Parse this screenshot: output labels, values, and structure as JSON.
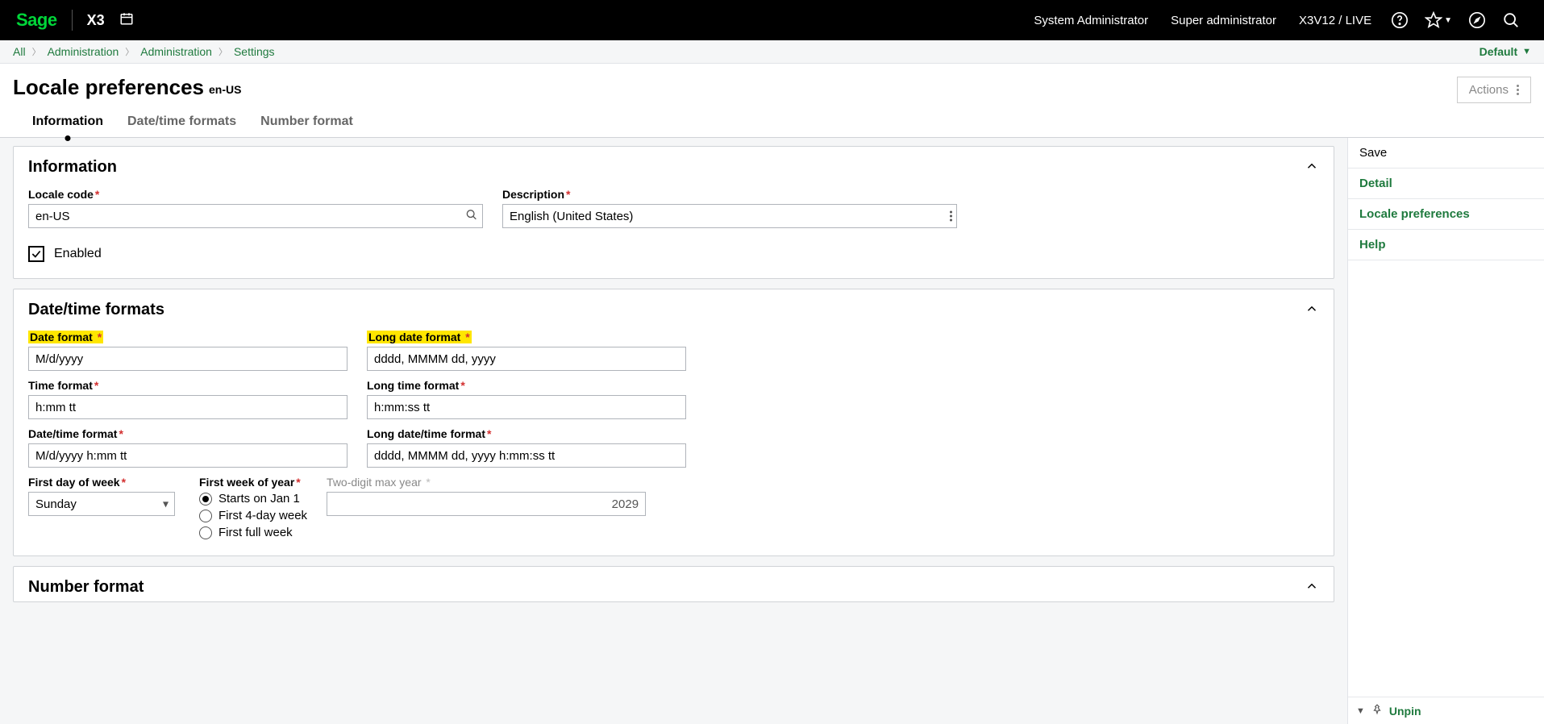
{
  "topbar": {
    "logo": "Sage",
    "product": "X3",
    "sys_admin": "System Administrator",
    "super_admin": "Super administrator",
    "env": "X3V12 / LIVE"
  },
  "breadcrumbs": {
    "b0": "All",
    "b1": "Administration",
    "b2": "Administration",
    "b3": "Settings",
    "default_label": "Default"
  },
  "page": {
    "title": "Locale preferences",
    "subtitle": "en-US",
    "actions_label": "Actions"
  },
  "tabs": {
    "t0": "Information",
    "t1": "Date/time formats",
    "t2": "Number format"
  },
  "info_section": {
    "title": "Information",
    "locale_code_label": "Locale code",
    "locale_code_value": "en-US",
    "description_label": "Description",
    "description_value": "English (United States)",
    "enabled_label": "Enabled"
  },
  "datetime_section": {
    "title": "Date/time formats",
    "date_format_label": "Date format",
    "date_format_value": "M/d/yyyy",
    "long_date_format_label": "Long date format",
    "long_date_format_value": "dddd, MMMM dd, yyyy",
    "time_format_label": "Time format",
    "time_format_value": "h:mm tt",
    "long_time_format_label": "Long time format",
    "long_time_format_value": "h:mm:ss tt",
    "datetime_format_label": "Date/time format",
    "datetime_format_value": "M/d/yyyy h:mm tt",
    "long_datetime_format_label": "Long date/time format",
    "long_datetime_format_value": "dddd, MMMM dd, yyyy h:mm:ss tt",
    "first_day_label": "First day of week",
    "first_day_value": "Sunday",
    "first_week_label": "First week of year",
    "radio_jan1": "Starts on Jan 1",
    "radio_4day": "First 4-day week",
    "radio_full": "First full week",
    "two_digit_label": "Two-digit max year",
    "two_digit_value": "2029"
  },
  "number_section": {
    "title": "Number format"
  },
  "right_panel": {
    "save": "Save",
    "detail": "Detail",
    "locale_prefs": "Locale preferences",
    "help": "Help",
    "unpin": "Unpin"
  }
}
